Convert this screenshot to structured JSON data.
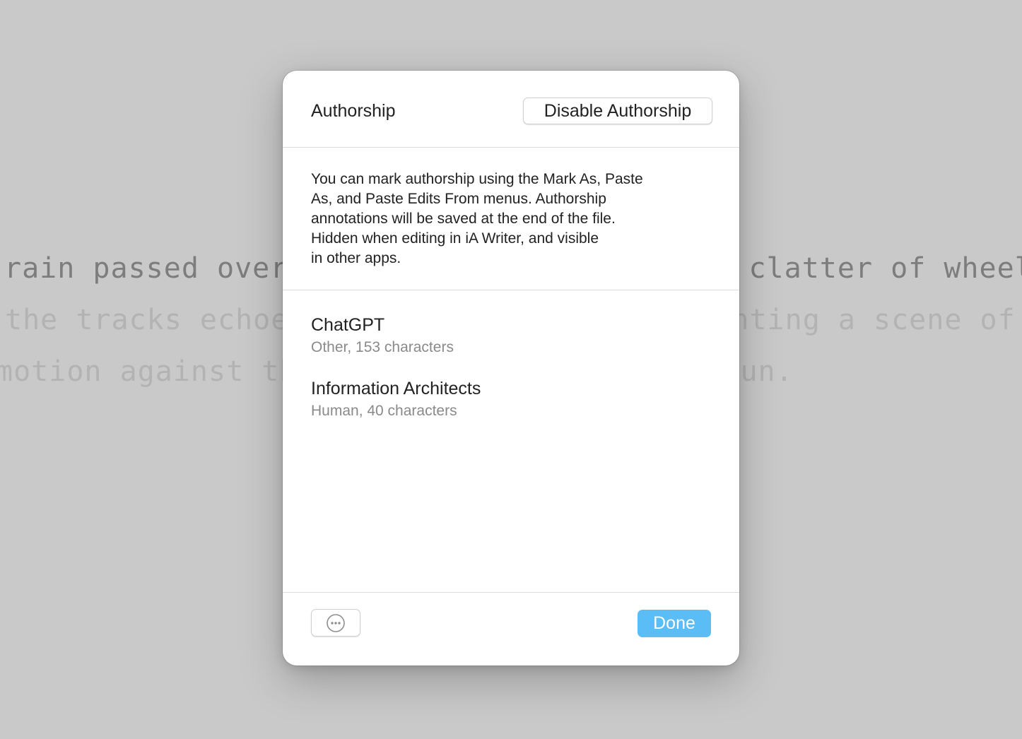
{
  "editor": {
    "lines": [
      "rain passed over the tracks, the rhythmic clatter of wheels",
      "the tracks echoed through the valley, painting a scene of",
      "motion against the backdrop of a setting sun."
    ]
  },
  "sheet": {
    "header": {
      "title": "Authorship",
      "disable_button_label": "Disable Authorship"
    },
    "info": {
      "lines": [
        "You can mark authorship using the Mark As, Paste",
        "As, and Paste Edits From menus. Authorship",
        "annotations will be saved at the end of the file.",
        "Hidden when editing in iA Writer, and visible",
        "in other apps."
      ]
    },
    "authors": [
      {
        "name": "ChatGPT",
        "detail": "Other, 153 characters"
      },
      {
        "name": "Information Architects",
        "detail": "Human, 40 characters"
      }
    ],
    "footer": {
      "more_button_icon": "ellipsis-circle-icon",
      "done_label": "Done"
    }
  },
  "colors": {
    "background": "#c9c9c9",
    "accent": "#5bbdf5",
    "primary_text": "#222222",
    "secondary_text": "#8a8a8a"
  }
}
